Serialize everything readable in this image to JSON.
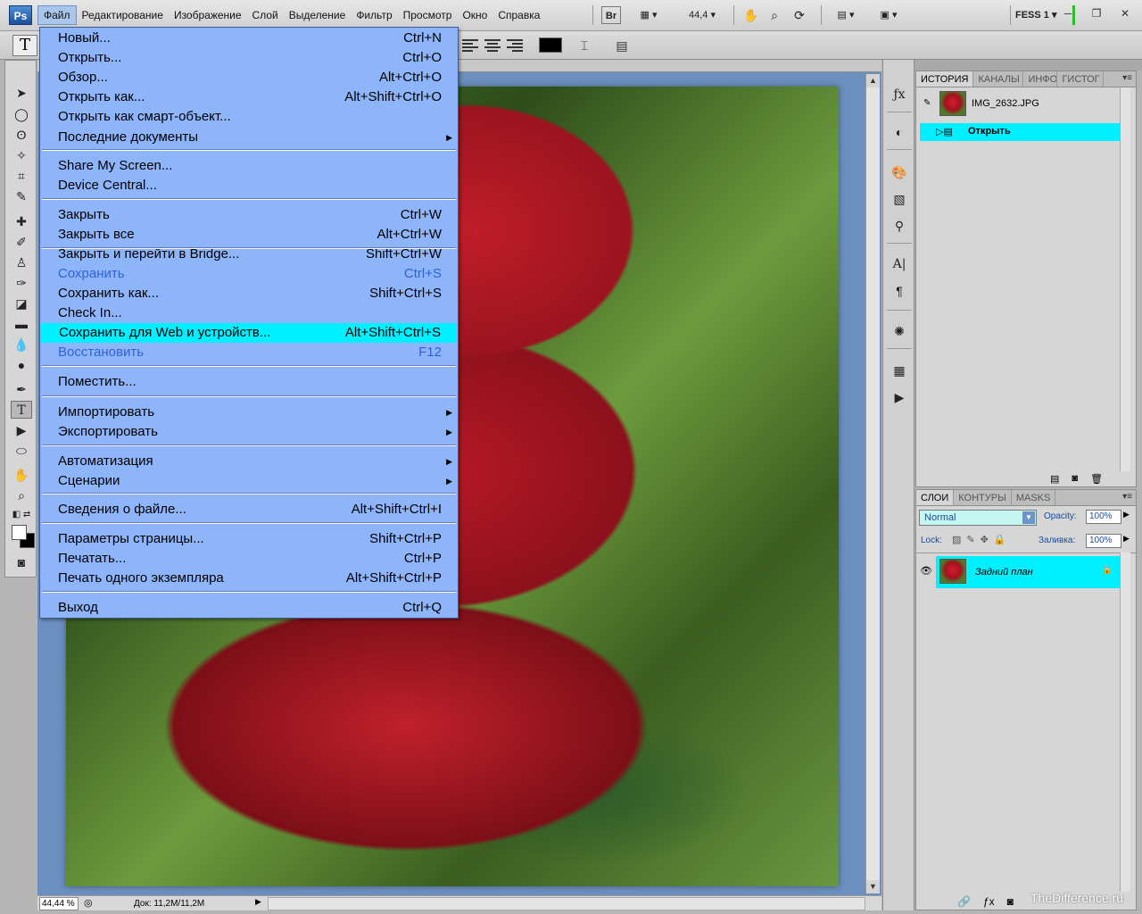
{
  "app": {
    "logo": "Ps",
    "workspace": "FESS 1"
  },
  "menubar": {
    "items": [
      "Файл",
      "Редактирование",
      "Изображение",
      "Слой",
      "Выделение",
      "Фильтр",
      "Просмотр",
      "Окно",
      "Справка"
    ],
    "bridge_label": "Br",
    "zoom": "44,4"
  },
  "options": {
    "tool": "T"
  },
  "file_menu": {
    "items": [
      {
        "label": "Новый...",
        "shortcut": "Ctrl+N"
      },
      {
        "label": "Открыть...",
        "shortcut": "Ctrl+O"
      },
      {
        "label": "Обзор...",
        "shortcut": "Alt+Ctrl+O"
      },
      {
        "label": "Открыть как...",
        "shortcut": "Alt+Shift+Ctrl+O"
      },
      {
        "label": "Открыть как смарт-объект...",
        "shortcut": ""
      },
      {
        "label": "Последние документы",
        "shortcut": ""
      },
      {
        "label": "Share My Screen...",
        "shortcut": ""
      },
      {
        "label": "Device Central...",
        "shortcut": ""
      },
      {
        "label": "Закрыть",
        "shortcut": "Ctrl+W"
      },
      {
        "label": "Закрыть все",
        "shortcut": "Alt+Ctrl+W"
      },
      {
        "label": "Закрыть и перейти в Bridge...",
        "shortcut": "Shift+Ctrl+W"
      },
      {
        "label": "Сохранить",
        "shortcut": "Ctrl+S"
      },
      {
        "label": "Сохранить как...",
        "shortcut": "Shift+Ctrl+S"
      },
      {
        "label": "Check In...",
        "shortcut": ""
      },
      {
        "label": "Сохранить для Web и устройств...",
        "shortcut": "Alt+Shift+Ctrl+S"
      },
      {
        "label": "Восстановить",
        "shortcut": "F12"
      },
      {
        "label": "Поместить...",
        "shortcut": ""
      },
      {
        "label": "Импортировать",
        "shortcut": ""
      },
      {
        "label": "Экспортировать",
        "shortcut": ""
      },
      {
        "label": "Автоматизация",
        "shortcut": ""
      },
      {
        "label": "Сценарии",
        "shortcut": ""
      },
      {
        "label": "Сведения о файле...",
        "shortcut": "Alt+Shift+Ctrl+I"
      },
      {
        "label": "Параметры страницы...",
        "shortcut": "Shift+Ctrl+P"
      },
      {
        "label": "Печатать...",
        "shortcut": "Ctrl+P"
      },
      {
        "label": "Печать одного экземпляра",
        "shortcut": "Alt+Shift+Ctrl+P"
      },
      {
        "label": "Выход",
        "shortcut": "Ctrl+Q"
      }
    ],
    "highlighted": "Сохранить для Web и устройств...",
    "disabled": [
      "Сохранить",
      "Восстановить"
    ]
  },
  "history_panel": {
    "tabs": [
      "ИСТОРИЯ",
      "КАНАЛЫ",
      "ИНФО",
      "ГИСТОГ"
    ],
    "snapshot": "IMG_2632.JPG",
    "state": "Открыть"
  },
  "layers_panel": {
    "tabs": [
      "СЛОИ",
      "КОНТУРЫ",
      "MASKS"
    ],
    "blend_mode": "Normal",
    "opacity_label": "Opacity:",
    "opacity": "100%",
    "lock_label": "Lock:",
    "fill_label": "Заливка:",
    "fill": "100%",
    "layer_name": "Задний план"
  },
  "status": {
    "zoom": "44,44 %",
    "doc": "Док: 11,2M/11,2M"
  },
  "watermark": "TheDifference.ru"
}
